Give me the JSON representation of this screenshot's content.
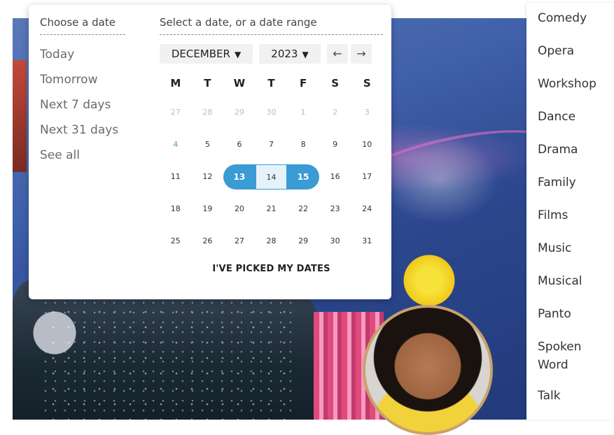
{
  "date_picker": {
    "quick_title": "Choose a date",
    "quick_options": [
      "Today",
      "Tomorrow",
      "Next 7 days",
      "Next 31 days",
      "See all"
    ],
    "range_title": "Select a date, or a date range",
    "month": "DECEMBER",
    "year": "2023",
    "caret": "▼",
    "prev_arrow": "←",
    "next_arrow": "→",
    "weekdays": [
      "M",
      "T",
      "W",
      "T",
      "F",
      "S",
      "S"
    ],
    "weeks": [
      [
        {
          "d": "27",
          "s": "muted"
        },
        {
          "d": "28",
          "s": "muted"
        },
        {
          "d": "29",
          "s": "muted"
        },
        {
          "d": "30",
          "s": "muted"
        },
        {
          "d": "1",
          "s": "muted"
        },
        {
          "d": "2",
          "s": "muted"
        },
        {
          "d": "3",
          "s": "muted"
        }
      ],
      [
        {
          "d": "4",
          "s": "today"
        },
        {
          "d": "5",
          "s": ""
        },
        {
          "d": "6",
          "s": ""
        },
        {
          "d": "7",
          "s": ""
        },
        {
          "d": "8",
          "s": ""
        },
        {
          "d": "9",
          "s": ""
        },
        {
          "d": "10",
          "s": ""
        }
      ],
      [
        {
          "d": "11",
          "s": ""
        },
        {
          "d": "12",
          "s": ""
        },
        {
          "d": "13",
          "s": "sel-start"
        },
        {
          "d": "14",
          "s": "in-range"
        },
        {
          "d": "15",
          "s": "sel-end"
        },
        {
          "d": "16",
          "s": ""
        },
        {
          "d": "17",
          "s": ""
        }
      ],
      [
        {
          "d": "18",
          "s": ""
        },
        {
          "d": "19",
          "s": ""
        },
        {
          "d": "20",
          "s": ""
        },
        {
          "d": "21",
          "s": ""
        },
        {
          "d": "22",
          "s": ""
        },
        {
          "d": "23",
          "s": ""
        },
        {
          "d": "24",
          "s": ""
        }
      ],
      [
        {
          "d": "25",
          "s": ""
        },
        {
          "d": "26",
          "s": ""
        },
        {
          "d": "27",
          "s": ""
        },
        {
          "d": "28",
          "s": ""
        },
        {
          "d": "29",
          "s": ""
        },
        {
          "d": "30",
          "s": ""
        },
        {
          "d": "31",
          "s": ""
        }
      ]
    ],
    "confirm_label": "I'VE PICKED MY DATES",
    "accent_color": "#3a9bd5"
  },
  "categories": [
    "Comedy",
    "Opera",
    "Workshop",
    "Dance",
    "Drama",
    "Family",
    "Films",
    "Music",
    "Musical",
    "Panto",
    "Spoken Word",
    "Talk"
  ]
}
